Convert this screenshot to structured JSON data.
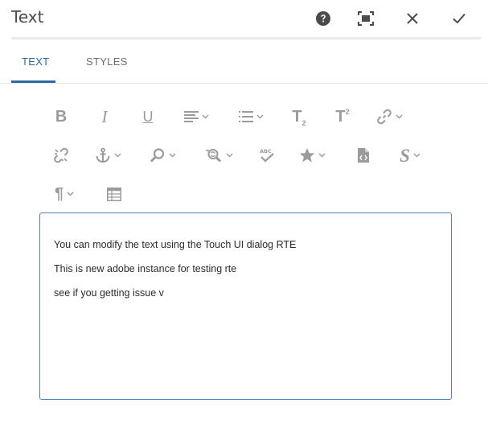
{
  "dialog": {
    "title": "Text",
    "actions": [
      {
        "name": "help-button",
        "icon": "help-icon"
      },
      {
        "name": "fullscreen-button",
        "icon": "fullscreen-icon"
      },
      {
        "name": "cancel-button",
        "icon": "close-icon"
      },
      {
        "name": "done-button",
        "icon": "checkmark-icon"
      }
    ]
  },
  "tabs": [
    {
      "label": "TEXT",
      "active": true
    },
    {
      "label": "STYLES",
      "active": false
    }
  ],
  "toolbar": {
    "tools": [
      {
        "name": "bold-button",
        "icon": "bold-icon",
        "glyph": "B",
        "dropdown": false
      },
      {
        "name": "italic-button",
        "icon": "italic-icon",
        "glyph": "I",
        "dropdown": false
      },
      {
        "name": "underline-button",
        "icon": "underline-icon",
        "glyph": "U",
        "dropdown": false
      },
      {
        "name": "justify-button",
        "icon": "align-left-icon",
        "dropdown": true
      },
      {
        "name": "lists-button",
        "icon": "list-bulleted-icon",
        "dropdown": true
      },
      {
        "name": "subscript-button",
        "icon": "subscript-icon",
        "glyph": "T",
        "dropdown": false
      },
      {
        "name": "superscript-button",
        "icon": "superscript-icon",
        "glyph": "T",
        "dropdown": false
      },
      {
        "name": "link-button",
        "icon": "link-icon",
        "dropdown": true
      },
      {
        "name": "unlink-button",
        "icon": "unlink-icon",
        "dropdown": false
      },
      {
        "name": "anchor-button",
        "icon": "anchor-icon",
        "dropdown": true
      },
      {
        "name": "find-button",
        "icon": "search-icon",
        "dropdown": true
      },
      {
        "name": "find-replace-button",
        "icon": "find-replace-icon",
        "dropdown": true
      },
      {
        "name": "spellcheck-button",
        "icon": "spellcheck-icon",
        "dropdown": false
      },
      {
        "name": "special-chars-button",
        "icon": "star-icon",
        "dropdown": true
      },
      {
        "name": "source-edit-button",
        "icon": "source-code-icon",
        "dropdown": false
      },
      {
        "name": "styles-button",
        "icon": "styles-icon",
        "glyph": "S",
        "dropdown": true
      },
      {
        "name": "paragraph-format-button",
        "icon": "paragraph-icon",
        "glyph": "¶",
        "dropdown": true
      },
      {
        "name": "table-button",
        "icon": "table-icon",
        "dropdown": false
      }
    ]
  },
  "editor": {
    "paragraphs": [
      "You can modify the text using the Touch UI dialog RTE",
      "This is new adobe instance for testing rte",
      "see if you getting issue v"
    ]
  },
  "colors": {
    "accent": "#2d6aa8",
    "icon": "#9b9b9b",
    "editor_border": "#4f81bd"
  }
}
